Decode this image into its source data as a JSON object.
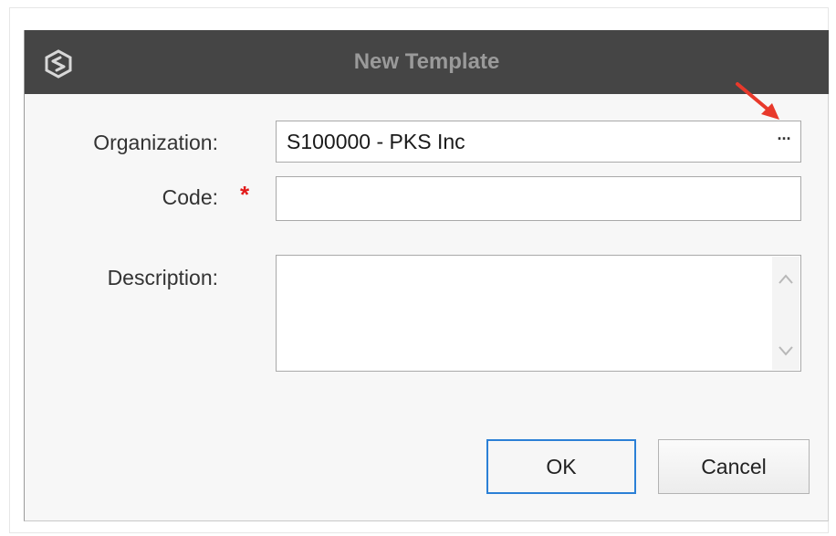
{
  "dialog": {
    "title": "New Template"
  },
  "form": {
    "organization_label": "Organization:",
    "organization_value": "S100000 - PKS Inc",
    "organization_lookup_label": "···",
    "code_label": "Code:",
    "code_required_marker": "*",
    "code_value": "",
    "description_label": "Description:",
    "description_value": ""
  },
  "buttons": {
    "ok_label": "OK",
    "cancel_label": "Cancel"
  },
  "colors": {
    "titlebar": "#454545",
    "title_text": "#9a9a9a",
    "required_marker": "#e21b1b",
    "focus_border": "#2b80d6",
    "annotation_arrow": "#e8392b"
  },
  "icons": {
    "app": "app-logo-icon",
    "scroll_up": "chevron-up-icon",
    "scroll_down": "chevron-down-icon",
    "annotation": "arrow-annotation-icon"
  }
}
